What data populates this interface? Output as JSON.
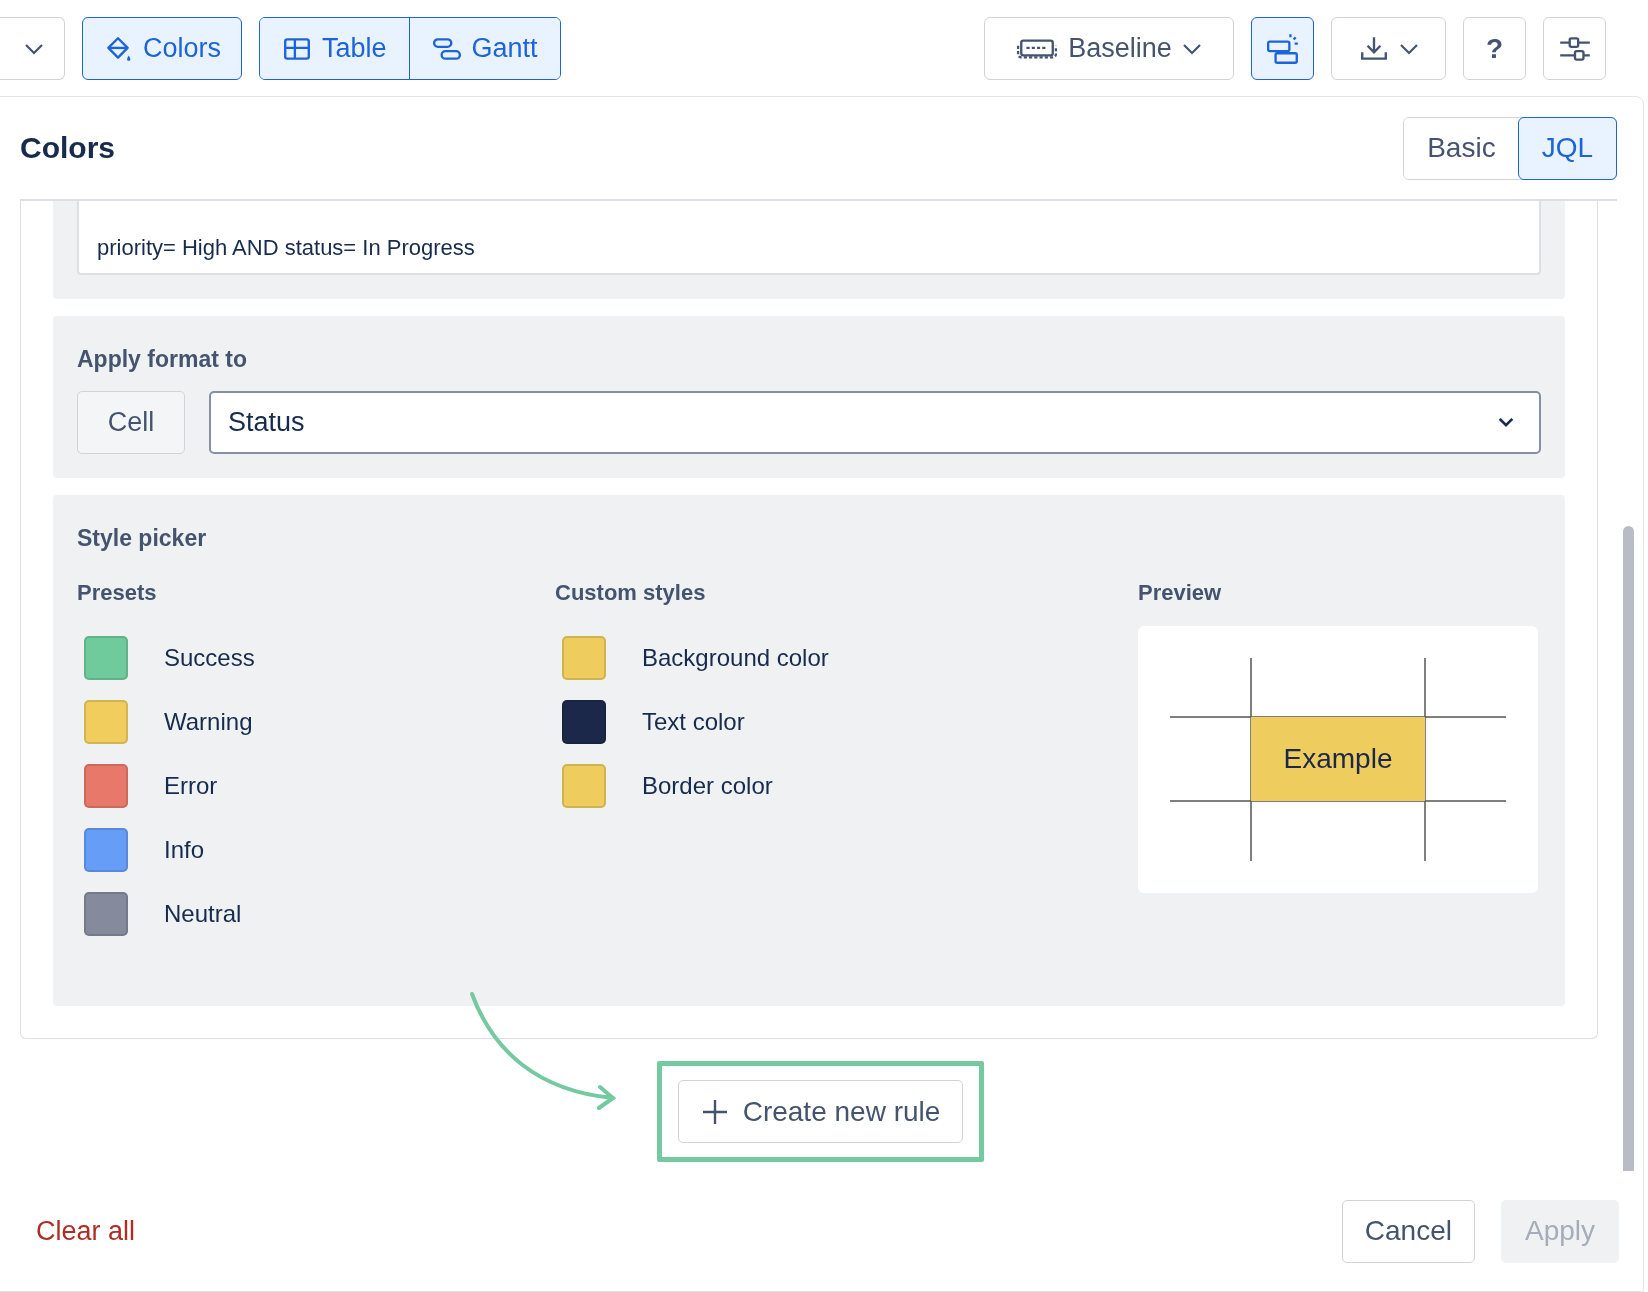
{
  "toolbar": {
    "colors_button": {
      "label": "Colors",
      "selected": true
    },
    "view_toggle": [
      {
        "label": "Table",
        "kind": "table",
        "selected": true
      },
      {
        "label": "Gantt",
        "kind": "gantt",
        "selected": true
      }
    ],
    "baseline_button": {
      "label": "Baseline"
    },
    "icon_buttons": [
      {
        "kind": "layout",
        "selected": true
      },
      {
        "kind": "download",
        "selected": false
      },
      {
        "kind": "help",
        "label": "?",
        "selected": false
      },
      {
        "kind": "settings",
        "selected": false
      }
    ]
  },
  "panel": {
    "title": "Colors",
    "mode_tabs": [
      {
        "label": "Basic",
        "selected": false
      },
      {
        "label": "JQL",
        "selected": true
      }
    ],
    "query_field": {
      "value": "priority= High AND status= In Progress"
    },
    "apply_format": {
      "label": "Apply format to",
      "scope_button": "Cell",
      "field_select": {
        "value": "Status"
      }
    },
    "style_picker": {
      "title": "Style picker",
      "presets": {
        "heading": "Presets",
        "items": [
          {
            "label": "Success",
            "color": "#6fcb9b"
          },
          {
            "label": "Warning",
            "color": "#f0cd5d"
          },
          {
            "label": "Error",
            "color": "#e8786a"
          },
          {
            "label": "Info",
            "color": "#669df6"
          },
          {
            "label": "Neutral",
            "color": "#858b9d"
          }
        ]
      },
      "custom_styles": {
        "heading": "Custom styles",
        "items": [
          {
            "label": "Background color",
            "kind": "background",
            "color": "#eecd5e"
          },
          {
            "label": "Text color",
            "kind": "text",
            "color": "#1b2849"
          },
          {
            "label": "Border color",
            "kind": "border",
            "color": "#eecd5e"
          }
        ]
      },
      "preview": {
        "heading": "Preview",
        "sample": "Example"
      }
    },
    "create_rule_button": {
      "label": "Create new rule"
    },
    "footer": {
      "clear_all": "Clear all",
      "cancel": "Cancel",
      "apply": {
        "label": "Apply",
        "disabled": true
      }
    }
  }
}
